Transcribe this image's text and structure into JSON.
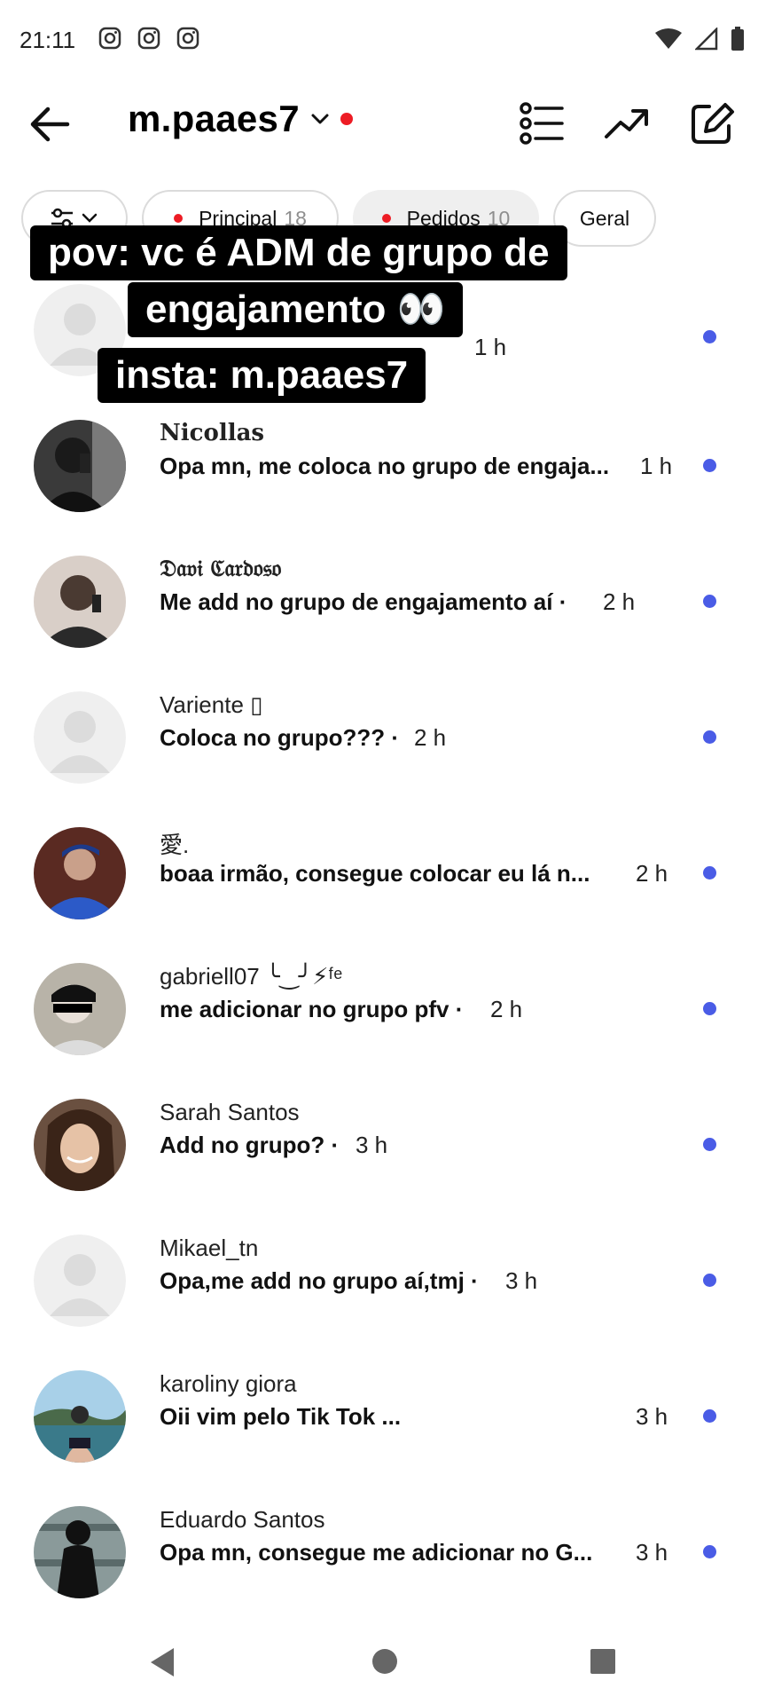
{
  "status": {
    "time": "21:11"
  },
  "header": {
    "account": "m.paaes7"
  },
  "chips": {
    "principal": {
      "label": "Principal",
      "count": "18"
    },
    "pedidos": {
      "label": "Pedidos",
      "count": "10"
    },
    "geral": {
      "label": "Geral"
    }
  },
  "overlay": {
    "line1": "pov: vc é ADM de grupo de",
    "line2": "engajamento 👀",
    "line3": "insta: m.paaes7"
  },
  "rows": [
    {
      "name": "",
      "message": "",
      "time": "1 h"
    },
    {
      "name": "Nicollas",
      "message": "Opa mn, me coloca no grupo de engaja...",
      "time": "1 h"
    },
    {
      "name": "𝔇𝔞𝔳𝔦 ℭ𝔞𝔯𝔡𝔬𝔰𝔬",
      "message": "Me add no grupo de engajamento aí ·",
      "time": "2 h"
    },
    {
      "name": "Variente ▯",
      "message": "Coloca no grupo??? ·",
      "time": "2 h"
    },
    {
      "name": "愛.",
      "message": "boaa irmão, consegue colocar eu lá n...",
      "time": "2 h"
    },
    {
      "name": "gabriell07 ╰‿╯⚡ᶠᵉ",
      "message": "me adicionar no grupo pfv ·",
      "time": "2 h"
    },
    {
      "name": "Sarah Santos",
      "message": "Add no grupo? ·",
      "time": "3 h"
    },
    {
      "name": "Mikael_tn",
      "message": "Opa,me add no grupo aí,tmj ·",
      "time": "3 h"
    },
    {
      "name": "karoliny giora",
      "message": "Oii  vim pelo Tik Tok ...",
      "time": "3 h"
    },
    {
      "name": "Eduardo Santos",
      "message": "Opa mn, consegue me adicionar no G...",
      "time": "3 h"
    }
  ]
}
